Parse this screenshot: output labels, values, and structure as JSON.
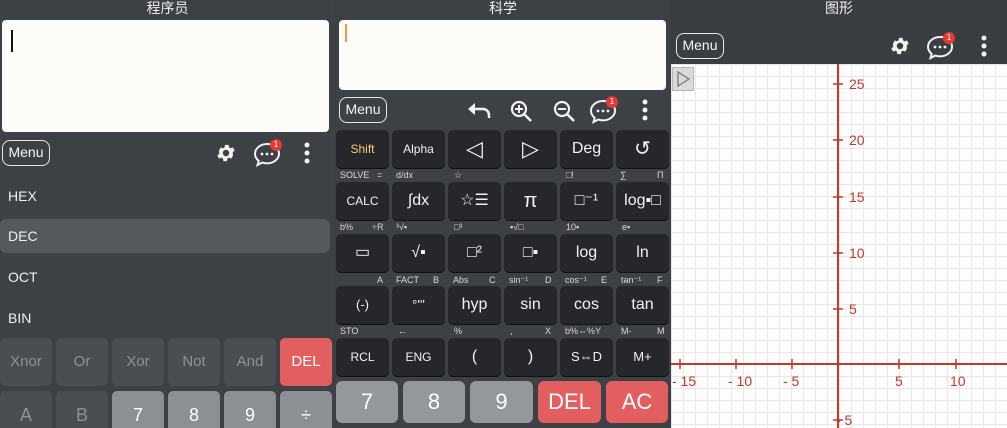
{
  "programmer": {
    "title": "程序员",
    "menu_label": "Menu",
    "badge": "1",
    "radix": [
      "HEX",
      "DEC",
      "OCT",
      "BIN"
    ],
    "selected_radix": "DEC",
    "row1": [
      "Xnor",
      "Or",
      "Xor",
      "Not",
      "And",
      "DEL"
    ],
    "row2": [
      "A",
      "B",
      "7",
      "8",
      "9",
      "÷"
    ]
  },
  "scientific": {
    "title": "科学",
    "menu_label": "Menu",
    "badge": "1",
    "row1": [
      "Shift",
      "Alpha",
      "◁",
      "▷",
      "Deg",
      "↺"
    ],
    "row1_labels": [
      "SOLVE",
      "=",
      "d/dx",
      "☆",
      "□!",
      "∑",
      "Π"
    ],
    "row2": [
      "CALC",
      "∫dx",
      "☆☰",
      "π",
      "□⁻¹",
      "log▪□"
    ],
    "row2_labels": [
      "b%",
      "÷R",
      "³√▪",
      "□³",
      "▪√□",
      "10▪",
      "e▪"
    ],
    "row3": [
      "▭",
      "√▪",
      "□²",
      "□▪",
      "log",
      "ln"
    ],
    "row3_labels": [
      "A",
      "FACT",
      "B",
      "Abs",
      "C",
      "sin⁻¹",
      "D",
      "cos⁻¹",
      "E",
      "tan⁻¹",
      "F"
    ],
    "row4": [
      "(-)",
      "°'''",
      "hyp",
      "sin",
      "cos",
      "tan"
    ],
    "row4_labels": [
      "STO",
      "←",
      "%",
      ",",
      "X",
      "b%⇔%Y",
      "M-",
      "M"
    ],
    "row5": [
      "RCL",
      "ENG",
      "(",
      ")",
      "S⇔D",
      "M+"
    ],
    "numrow": [
      "7",
      "8",
      "9",
      "DEL",
      "AC"
    ]
  },
  "graph": {
    "title": "图形",
    "menu_label": "Menu",
    "badge": "1",
    "y_ticks": [
      "25",
      "20",
      "15",
      "10",
      "5",
      "- 5"
    ],
    "x_ticks": [
      "- 15",
      "- 10",
      "- 5",
      "5",
      "10"
    ]
  }
}
